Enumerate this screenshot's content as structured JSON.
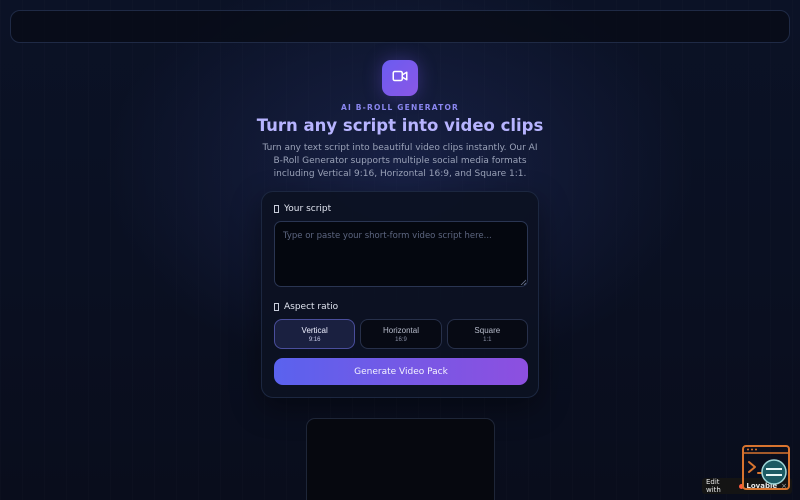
{
  "header": {
    "eyebrow": "AI B-ROLL GENERATOR",
    "title": "Turn any script into video clips",
    "subtitle": "Turn any text script into beautiful video clips instantly. Our AI B-Roll Generator supports multiple social media formats including Vertical 9:16, Horizontal 16:9, and Square 1:1."
  },
  "form": {
    "script_label": "Your script",
    "script_placeholder": "Type or paste your short-form video script here...",
    "script_value": "",
    "aspect_label": "Aspect ratio",
    "ratios": [
      {
        "name": "Vertical",
        "value": "9:16",
        "selected": true
      },
      {
        "name": "Horizontal",
        "value": "16:9",
        "selected": false
      },
      {
        "name": "Square",
        "value": "1:1",
        "selected": false
      }
    ],
    "generate_label": "Generate Video Pack"
  },
  "badge": {
    "prefix": "Edit with",
    "brand": "Lovable",
    "close": "×"
  },
  "icons": {
    "logo": "video-camera-icon",
    "script_label_icon": "file-text-icon",
    "aspect_label_icon": "ratio-icon",
    "widget": "terminal-icon"
  },
  "colors": {
    "accent": "#6b5cf0",
    "accent_end": "#8d4fe0",
    "title": "#b7b4ff",
    "background": "#0a1022"
  }
}
